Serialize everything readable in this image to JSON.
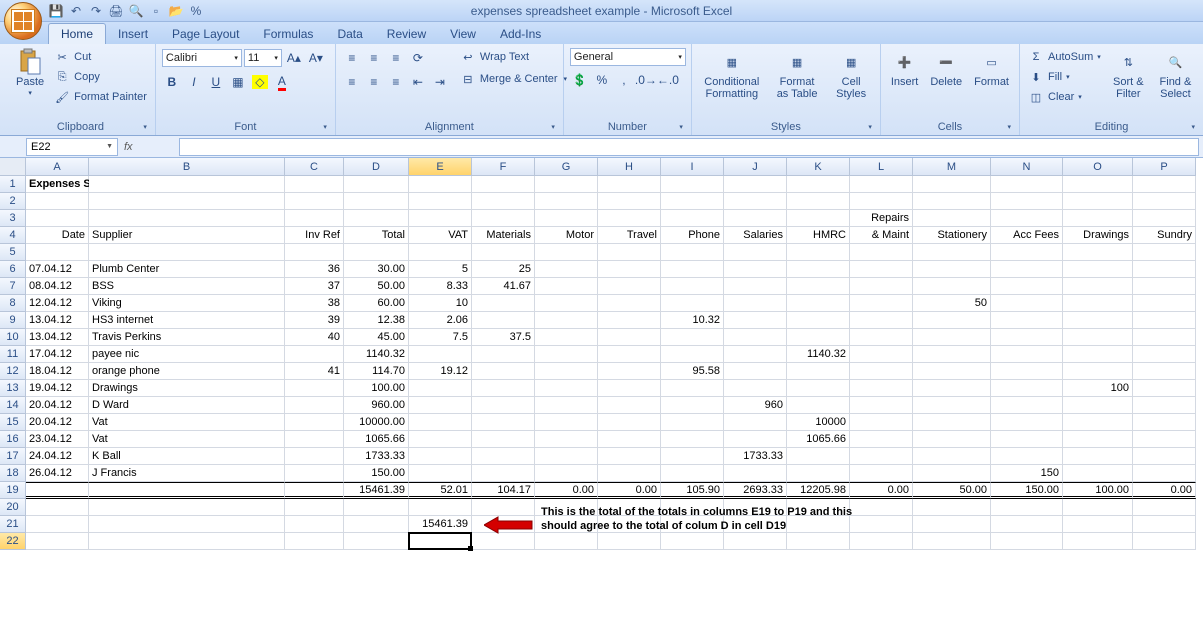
{
  "title": "expenses spreadsheet example - Microsoft Excel",
  "tabs": [
    "Home",
    "Insert",
    "Page Layout",
    "Formulas",
    "Data",
    "Review",
    "View",
    "Add-Ins"
  ],
  "active_tab": 0,
  "ribbon": {
    "clipboard": {
      "label": "Clipboard",
      "paste": "Paste",
      "cut": "Cut",
      "copy": "Copy",
      "fp": "Format Painter"
    },
    "font": {
      "label": "Font",
      "name": "Calibri",
      "size": "11"
    },
    "alignment": {
      "label": "Alignment",
      "wrap": "Wrap Text",
      "merge": "Merge & Center"
    },
    "number": {
      "label": "Number",
      "format": "General"
    },
    "styles": {
      "label": "Styles",
      "cond": "Conditional Formatting",
      "table": "Format as Table",
      "cell": "Cell Styles"
    },
    "cells": {
      "label": "Cells",
      "insert": "Insert",
      "delete": "Delete",
      "format": "Format"
    },
    "editing": {
      "label": "Editing",
      "autosum": "AutoSum",
      "fill": "Fill",
      "clear": "Clear",
      "sort": "Sort & Filter",
      "find": "Find & Select"
    }
  },
  "namebox": "E22",
  "formula": "",
  "columns": [
    {
      "l": "A",
      "w": 63
    },
    {
      "l": "B",
      "w": 196
    },
    {
      "l": "C",
      "w": 59
    },
    {
      "l": "D",
      "w": 65
    },
    {
      "l": "E",
      "w": 63
    },
    {
      "l": "F",
      "w": 63
    },
    {
      "l": "G",
      "w": 63
    },
    {
      "l": "H",
      "w": 63
    },
    {
      "l": "I",
      "w": 63
    },
    {
      "l": "J",
      "w": 63
    },
    {
      "l": "K",
      "w": 63
    },
    {
      "l": "L",
      "w": 63
    },
    {
      "l": "M",
      "w": 78
    },
    {
      "l": "N",
      "w": 72
    },
    {
      "l": "O",
      "w": 70
    },
    {
      "l": "P",
      "w": 63
    }
  ],
  "sel_col": "E",
  "sel_row": 22,
  "rows_count": 22,
  "heading_cell": {
    "r": 1,
    "c": "A",
    "v": "Expenses Spreadsheet Example"
  },
  "repairs_cell": {
    "r": 3,
    "c": "L",
    "v": "Repairs"
  },
  "header_row": 4,
  "headers": {
    "A": "Date",
    "B": "Supplier",
    "C": "Inv Ref",
    "D": "Total",
    "E": "VAT",
    "F": "Materials",
    "G": "Motor",
    "H": "Travel",
    "I": "Phone",
    "J": "Salaries",
    "K": "HMRC",
    "L": "& Maint",
    "M": "Stationery",
    "N": "Acc Fees",
    "O": "Drawings",
    "P": "Sundry"
  },
  "data": {
    "6": {
      "A": "07.04.12",
      "B": "Plumb Center",
      "C": "36",
      "D": "30.00",
      "E": "5",
      "F": "25"
    },
    "7": {
      "A": "08.04.12",
      "B": "BSS",
      "C": "37",
      "D": "50.00",
      "E": "8.33",
      "F": "41.67"
    },
    "8": {
      "A": "12.04.12",
      "B": "Viking",
      "C": "38",
      "D": "60.00",
      "E": "10",
      "M": "50"
    },
    "9": {
      "A": "13.04.12",
      "B": "HS3 internet",
      "C": "39",
      "D": "12.38",
      "E": "2.06",
      "I": "10.32"
    },
    "10": {
      "A": "13.04.12",
      "B": "Travis Perkins",
      "C": "40",
      "D": "45.00",
      "E": "7.5",
      "F": "37.5"
    },
    "11": {
      "A": "17.04.12",
      "B": "payee nic",
      "D": "1140.32",
      "K": "1140.32"
    },
    "12": {
      "A": "18.04.12",
      "B": "orange phone",
      "C": "41",
      "D": "114.70",
      "E": "19.12",
      "I": "95.58"
    },
    "13": {
      "A": "19.04.12",
      "B": "Drawings",
      "D": "100.00",
      "O": "100"
    },
    "14": {
      "A": "20.04.12",
      "B": "D Ward",
      "D": "960.00",
      "J": "960"
    },
    "15": {
      "A": "20.04.12",
      "B": "Vat",
      "D": "10000.00",
      "K": "10000"
    },
    "16": {
      "A": "23.04.12",
      "B": "Vat",
      "D": "1065.66",
      "K": "1065.66"
    },
    "17": {
      "A": "24.04.12",
      "B": "K Ball",
      "D": "1733.33",
      "J": "1733.33"
    },
    "18": {
      "A": "26.04.12",
      "B": "J Francis",
      "D": "150.00",
      "N": "150"
    },
    "19": {
      "D": "15461.39",
      "E": "52.01",
      "F": "104.17",
      "G": "0.00",
      "H": "0.00",
      "I": "105.90",
      "J": "2693.33",
      "K": "12205.98",
      "L": "0.00",
      "M": "50.00",
      "N": "150.00",
      "O": "100.00",
      "P": "0.00"
    },
    "21": {
      "E": "15461.39"
    }
  },
  "totals_row": 19,
  "annot": {
    "line1": "This is the total of the totals in columns E19 to P19 and this",
    "line2": "should agree to the total of colum D in cell D19"
  },
  "chart_data": {
    "type": "table",
    "title": "Expenses Spreadsheet Example",
    "columns": [
      "Date",
      "Supplier",
      "Inv Ref",
      "Total",
      "VAT",
      "Materials",
      "Motor",
      "Travel",
      "Phone",
      "Salaries",
      "HMRC",
      "Repairs & Maint",
      "Stationery",
      "Acc Fees",
      "Drawings",
      "Sundry"
    ],
    "rows": [
      [
        "07.04.12",
        "Plumb Center",
        36,
        30.0,
        5,
        25,
        null,
        null,
        null,
        null,
        null,
        null,
        null,
        null,
        null,
        null
      ],
      [
        "08.04.12",
        "BSS",
        37,
        50.0,
        8.33,
        41.67,
        null,
        null,
        null,
        null,
        null,
        null,
        null,
        null,
        null,
        null
      ],
      [
        "12.04.12",
        "Viking",
        38,
        60.0,
        10,
        null,
        null,
        null,
        null,
        null,
        null,
        null,
        50,
        null,
        null,
        null
      ],
      [
        "13.04.12",
        "HS3 internet",
        39,
        12.38,
        2.06,
        null,
        null,
        null,
        10.32,
        null,
        null,
        null,
        null,
        null,
        null,
        null
      ],
      [
        "13.04.12",
        "Travis Perkins",
        40,
        45.0,
        7.5,
        37.5,
        null,
        null,
        null,
        null,
        null,
        null,
        null,
        null,
        null,
        null
      ],
      [
        "17.04.12",
        "payee nic",
        null,
        1140.32,
        null,
        null,
        null,
        null,
        null,
        null,
        1140.32,
        null,
        null,
        null,
        null,
        null
      ],
      [
        "18.04.12",
        "orange phone",
        41,
        114.7,
        19.12,
        null,
        null,
        null,
        95.58,
        null,
        null,
        null,
        null,
        null,
        null,
        null
      ],
      [
        "19.04.12",
        "Drawings",
        null,
        100.0,
        null,
        null,
        null,
        null,
        null,
        null,
        null,
        null,
        null,
        null,
        100,
        null
      ],
      [
        "20.04.12",
        "D Ward",
        null,
        960.0,
        null,
        null,
        null,
        null,
        null,
        960,
        null,
        null,
        null,
        null,
        null,
        null
      ],
      [
        "20.04.12",
        "Vat",
        null,
        10000.0,
        null,
        null,
        null,
        null,
        null,
        null,
        10000,
        null,
        null,
        null,
        null,
        null
      ],
      [
        "23.04.12",
        "Vat",
        null,
        1065.66,
        null,
        null,
        null,
        null,
        null,
        null,
        1065.66,
        null,
        null,
        null,
        null,
        null
      ],
      [
        "24.04.12",
        "K Ball",
        null,
        1733.33,
        null,
        null,
        null,
        null,
        null,
        1733.33,
        null,
        null,
        null,
        null,
        null,
        null
      ],
      [
        "26.04.12",
        "J Francis",
        null,
        150.0,
        null,
        null,
        null,
        null,
        null,
        null,
        null,
        null,
        null,
        150,
        null,
        null
      ]
    ],
    "totals": {
      "Total": 15461.39,
      "VAT": 52.01,
      "Materials": 104.17,
      "Motor": 0.0,
      "Travel": 0.0,
      "Phone": 105.9,
      "Salaries": 2693.33,
      "HMRC": 12205.98,
      "Repairs & Maint": 0.0,
      "Stationery": 50.0,
      "Acc Fees": 150.0,
      "Drawings": 100.0,
      "Sundry": 0.0
    },
    "grand_total_check": 15461.39
  }
}
